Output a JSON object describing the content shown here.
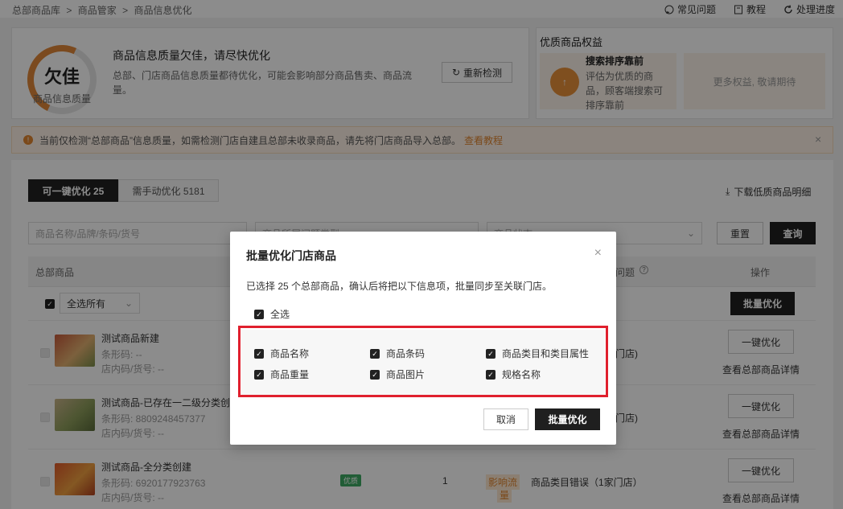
{
  "breadcrumb": [
    "总部商品库",
    ">",
    "商品管家",
    ">",
    "商品信息优化"
  ],
  "toplinks": [
    {
      "icon": "help-circle-icon",
      "label": "常见问题"
    },
    {
      "icon": "book-icon",
      "label": "教程"
    },
    {
      "icon": "refresh-icon",
      "label": "处理进度"
    }
  ],
  "quality": {
    "grade": "欠佳",
    "grade_label": "商品信息质量",
    "title": "商品信息质量欠佳，请尽快优化",
    "desc_line1": "总部、门店商品信息质量都待优化，可能会影响部分商品售卖、商品流",
    "desc_line2": "量。",
    "recheck_label": "重新检测"
  },
  "benefits": {
    "title": "优质商品权益",
    "item_title": "搜索排序靠前",
    "item_desc_1": "评估为优质的商",
    "item_desc_2": "品，顾客端搜索可",
    "item_desc_3": "排序靠前",
    "more": "更多权益, 敬请期待"
  },
  "notice": {
    "text": "当前仅检测“总部商品”信息质量，如需检测门店自建且总部未收录商品，请先将门店商品导入总部。",
    "link": "查看教程"
  },
  "tabs": [
    {
      "label": "可一键优化 25"
    },
    {
      "label": "需手动优化 5181"
    }
  ],
  "download_label": "下载低质商品明细",
  "filters": {
    "name_placeholder": "商品名称/品牌/条码/货号",
    "issue_placeholder": "商品所属问题类型",
    "store_placeholder": "商品状态",
    "reset": "重置",
    "search": "查询"
  },
  "table": {
    "col_product": "总部商品",
    "col_issue": "问题",
    "col_action": "操作",
    "select_all": "全选所有",
    "batch_optimize": "批量优化",
    "rows": [
      {
        "name": "测试商品新建",
        "barcode": "条形码: --",
        "sku": "店内码/货号: --",
        "issue_tail": "门店)",
        "action": "一键优化",
        "detail": "查看总部商品详情"
      },
      {
        "name": "测试商品-已存在一二级分类创",
        "barcode": "条形码: 8809248457377",
        "sku": "店内码/货号: --",
        "issue_tail": "门店)",
        "action": "一键优化",
        "detail": "查看总部商品详情"
      },
      {
        "name": "测试商品-全分类创建",
        "barcode": "条形码: 6920177923763",
        "sku": "店内码/货号: --",
        "badge": "优质",
        "count": "1",
        "warn_1": "影响流",
        "warn_2": "量",
        "issue": "商品类目错误（1家门店）",
        "action": "一键优化",
        "detail": "查看总部商品详情"
      }
    ]
  },
  "modal": {
    "title": "批量优化门店商品",
    "desc": "已选择 25 个总部商品，确认后将把以下信息项，批量同步至关联门店。",
    "select_all": "全选",
    "options": [
      "商品名称",
      "商品条码",
      "商品类目和类目属性",
      "商品重量",
      "商品图片",
      "规格名称"
    ],
    "cancel": "取消",
    "confirm": "批量优化"
  }
}
